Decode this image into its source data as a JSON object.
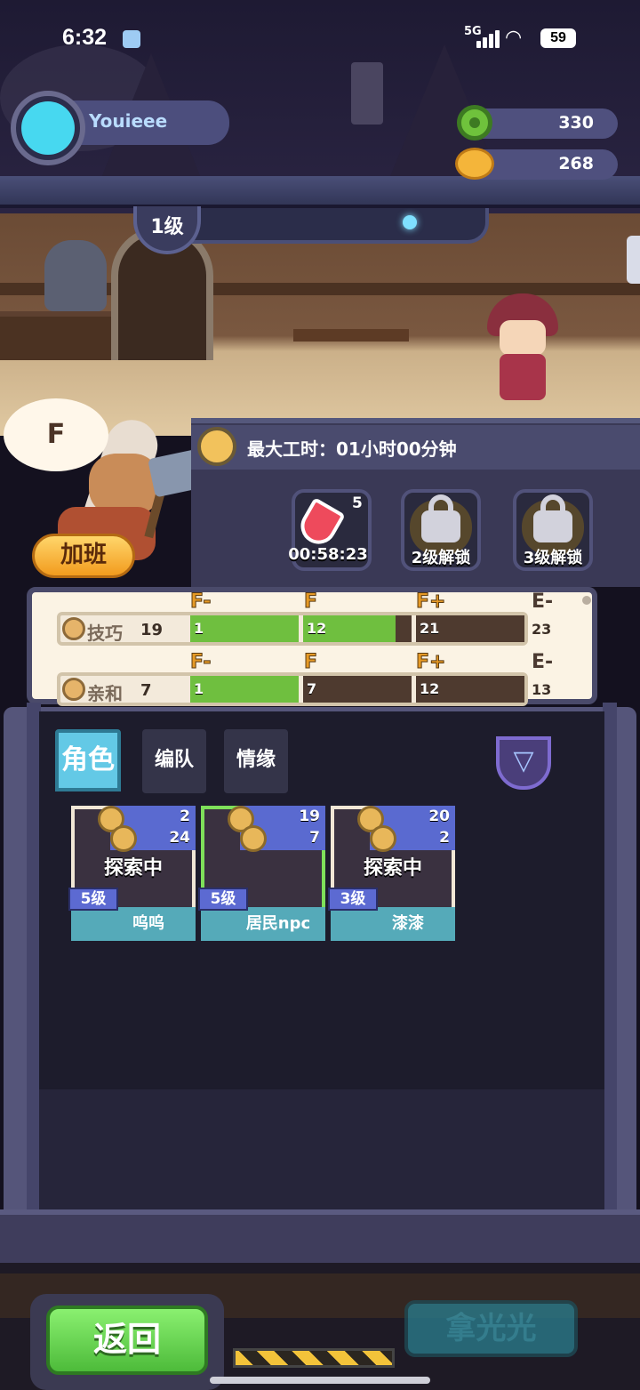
{
  "status_bar": {
    "time": "6:32",
    "network": "5G",
    "battery": "59"
  },
  "profile": {
    "username": "Youieee"
  },
  "currency": {
    "green_gem": "330",
    "gold_coin": "268"
  },
  "tavern": {
    "level": "1级"
  },
  "character": {
    "grade_bubble": "F",
    "overtime_label": "加班"
  },
  "work": {
    "max_hours_text": "最大工时：01小时00分钟",
    "slots": [
      {
        "count": "5",
        "label": "00:58:23"
      },
      {
        "label": "2级解锁"
      },
      {
        "label": "3级解锁"
      }
    ]
  },
  "stats": [
    {
      "label": "技巧",
      "value": "19",
      "grades": [
        "F-",
        "F",
        "F+",
        "E-"
      ],
      "thresholds": [
        "1",
        "12",
        "21",
        "23"
      ],
      "segment_fill": [
        1.0,
        0.85,
        0.0
      ]
    },
    {
      "label": "亲和",
      "value": "7",
      "grades": [
        "F-",
        "F",
        "F+",
        "E-"
      ],
      "thresholds": [
        "1",
        "7",
        "12",
        "13"
      ],
      "segment_fill": [
        1.0,
        0.0,
        0.0
      ]
    }
  ],
  "tabs": [
    "角色",
    "编队",
    "情缘"
  ],
  "cards": [
    {
      "skill": "2",
      "charm": "24",
      "status": "探索中",
      "level": "5级",
      "name": "呜呜"
    },
    {
      "skill": "19",
      "charm": "7",
      "status": "",
      "level": "5级",
      "name": "居民npc"
    },
    {
      "skill": "20",
      "charm": "2",
      "status": "探索中",
      "level": "3级",
      "name": "漆漆"
    }
  ],
  "bottom": {
    "back_label": "返回",
    "grab_label": "拿光光"
  },
  "colors": {
    "accent_cyan": "#63c9e6",
    "progress_green": "#6fbf3f",
    "button_green": "#4dbb3a",
    "grade_orange": "#e69a26"
  }
}
